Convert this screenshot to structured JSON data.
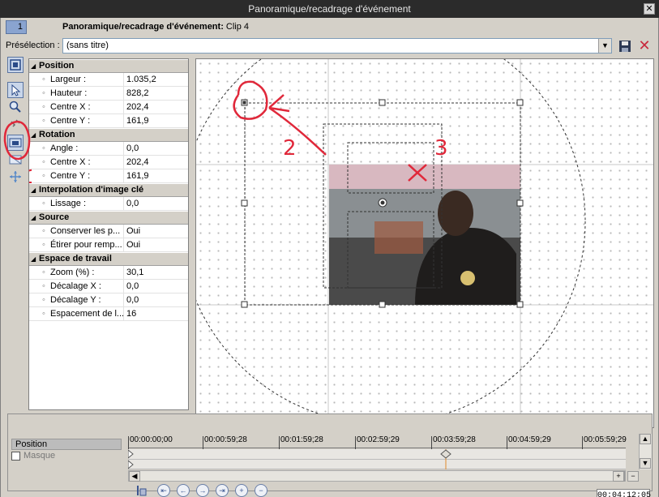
{
  "window": {
    "title": "Panoramique/recadrage d'événement",
    "close_glyph": "✕"
  },
  "header": {
    "track_number": "1",
    "title_bold": "Panoramique/recadrage d'événement:",
    "title_rest": " Clip 4"
  },
  "preset": {
    "label": "Présélection :",
    "value": "(sans titre)",
    "dropdown_glyph": "▼",
    "delete_glyph": "✕"
  },
  "properties": {
    "sections": [
      {
        "title": "Position",
        "rows": [
          {
            "key": "Largeur :",
            "value": "1.035,2"
          },
          {
            "key": "Hauteur :",
            "value": "828,2"
          },
          {
            "key": "Centre X :",
            "value": "202,4"
          },
          {
            "key": "Centre Y :",
            "value": "161,9"
          }
        ]
      },
      {
        "title": "Rotation",
        "rows": [
          {
            "key": "Angle :",
            "value": "0,0"
          },
          {
            "key": "Centre X :",
            "value": "202,4"
          },
          {
            "key": "Centre Y :",
            "value": "161,9"
          }
        ]
      },
      {
        "title": "Interpolation d'image clé",
        "rows": [
          {
            "key": "Lissage :",
            "value": "0,0"
          }
        ]
      },
      {
        "title": "Source",
        "rows": [
          {
            "key": "Conserver les p...",
            "value": "Oui"
          },
          {
            "key": "Étirer pour remp...",
            "value": "Oui"
          }
        ]
      },
      {
        "title": "Espace de travail",
        "rows": [
          {
            "key": "Zoom (%) :",
            "value": "30,1"
          },
          {
            "key": "Décalage X :",
            "value": "0,0"
          },
          {
            "key": "Décalage Y :",
            "value": "0,0"
          },
          {
            "key": "Espacement de l...",
            "value": "16"
          }
        ]
      }
    ]
  },
  "annotations": {
    "label_1": "1",
    "label_2": "2",
    "label_3": "3"
  },
  "timeline": {
    "tracks": {
      "position": "Position",
      "mask": "Masque"
    },
    "ruler": [
      "00:00:00;00",
      "00:00:59;28",
      "00:01:59;28",
      "00:02:59;29",
      "00:03:59;28",
      "00:04:59;29",
      "00:05:59;29"
    ],
    "scroll_left": "◀",
    "scroll_right": "▶",
    "scroll_up": "▲",
    "scroll_down": "▼",
    "zoom_plus": "+",
    "zoom_minus": "−",
    "transport": [
      "⇤",
      "←",
      "→",
      "⇥",
      "+",
      "−"
    ],
    "timecode": "00:04:12;05"
  }
}
